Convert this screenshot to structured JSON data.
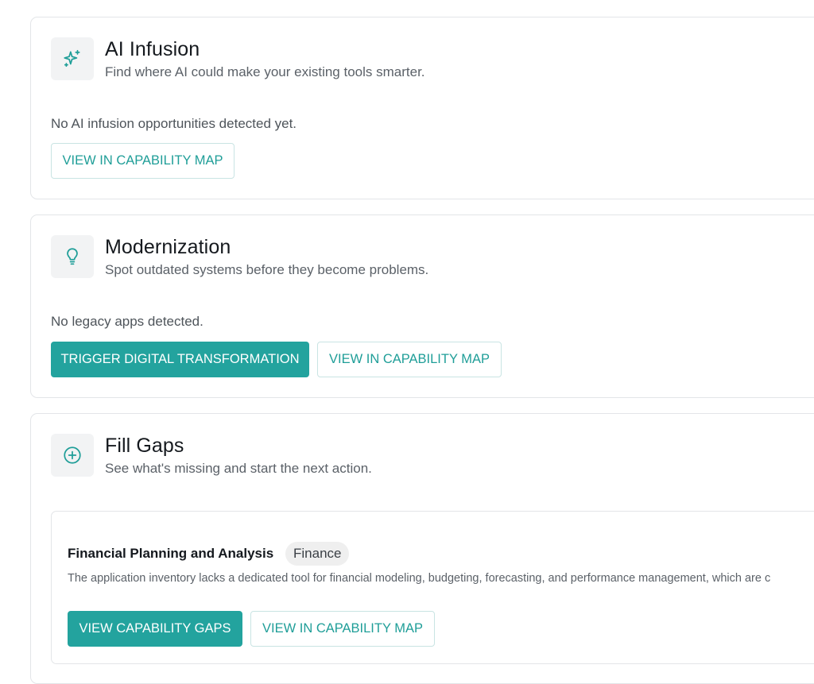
{
  "colors": {
    "accent": "#23a39e",
    "accent_text": "#1f9e98",
    "card_border": "#e3e5e8",
    "icon_bg": "#f2f3f4",
    "badge_bg": "#efefef"
  },
  "sections": [
    {
      "icon": "sparkles-icon",
      "title": "AI Infusion",
      "subtitle": "Find where AI could make your existing tools smarter.",
      "status": "No AI infusion opportunities detected yet.",
      "buttons": {
        "map": "VIEW IN CAPABILITY MAP"
      }
    },
    {
      "icon": "lightbulb-icon",
      "title": "Modernization",
      "subtitle": "Spot outdated systems before they become problems.",
      "status": "No legacy apps detected.",
      "buttons": {
        "trigger": "TRIGGER DIGITAL TRANSFORMATION",
        "map": "VIEW IN CAPABILITY MAP"
      }
    },
    {
      "icon": "plus-circle-icon",
      "title": "Fill Gaps",
      "subtitle": "See what's missing and start the next action.",
      "items": [
        {
          "title": "Financial Planning and Analysis",
          "badge": "Finance",
          "description": "The application inventory lacks a dedicated tool for financial modeling, budgeting, forecasting, and performance management, which are c",
          "buttons": {
            "gaps": "VIEW CAPABILITY GAPS",
            "map": "VIEW IN CAPABILITY MAP"
          }
        }
      ]
    }
  ]
}
